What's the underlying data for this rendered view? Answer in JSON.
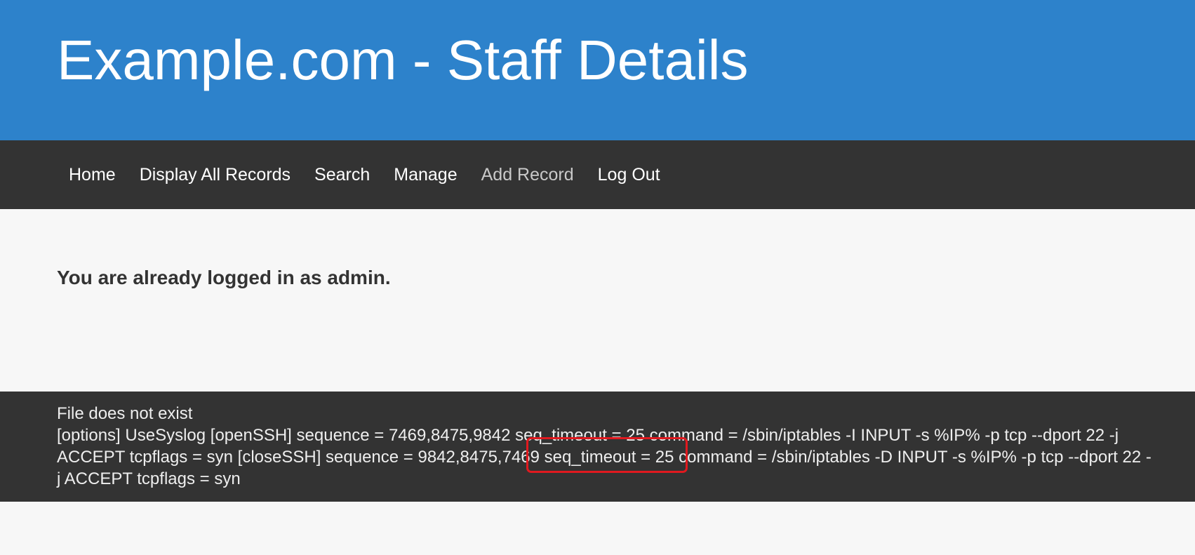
{
  "header": {
    "title": "Example.com - Staff Details"
  },
  "nav": {
    "items": [
      {
        "label": "Home"
      },
      {
        "label": "Display All Records"
      },
      {
        "label": "Search"
      },
      {
        "label": "Manage"
      },
      {
        "label": "Add Record"
      },
      {
        "label": "Log Out"
      }
    ]
  },
  "main": {
    "status_message": "You are already logged in as admin."
  },
  "footer": {
    "line1": "File does not exist",
    "line2": "[options] UseSyslog [openSSH] sequence = 7469,8475,9842 seq_timeout = 25 command = /sbin/iptables -I INPUT -s %IP% -p tcp --dport 22 -j ACCEPT tcpflags = syn [closeSSH] sequence = 9842,8475,7469 seq_timeout = 25 command = /sbin/iptables -D INPUT -s %IP% -p tcp --dport 22 -j ACCEPT tcpflags = syn"
  },
  "colors": {
    "header_bg": "#2d82cb",
    "nav_bg": "#333333",
    "page_bg": "#f7f7f7",
    "highlight": "#e0191f"
  }
}
